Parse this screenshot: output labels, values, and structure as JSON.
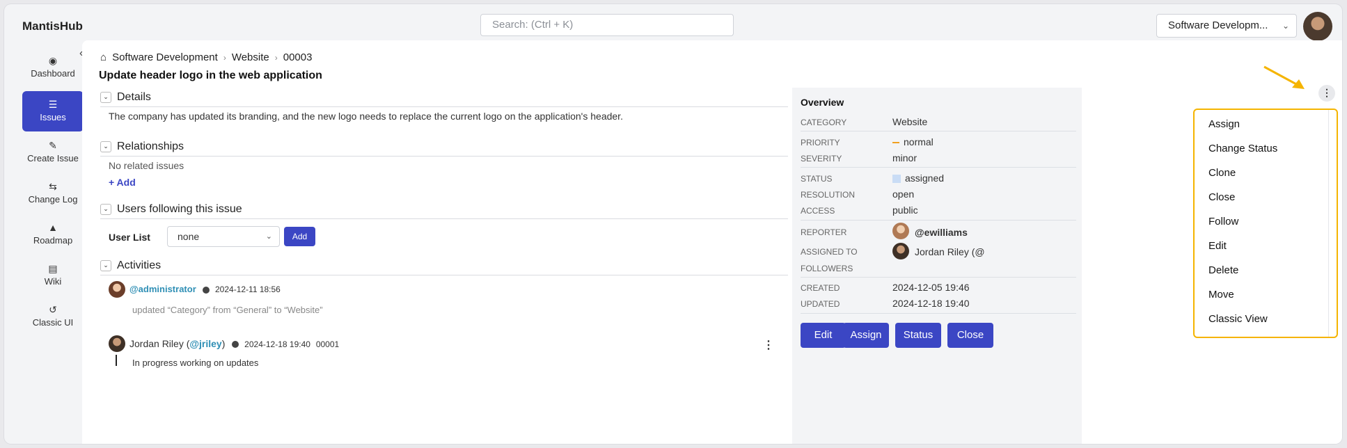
{
  "app": {
    "brand": "MantisHub"
  },
  "search": {
    "placeholder": "Search: (Ctrl + K)"
  },
  "project_selector": {
    "value": "Software Developm..."
  },
  "sidebar": {
    "items": [
      {
        "label": "Dashboard",
        "icon": "palette-icon"
      },
      {
        "label": "Issues",
        "icon": "list-icon"
      },
      {
        "label": "Create Issue",
        "icon": "edit-icon"
      },
      {
        "label": "Change Log",
        "icon": "change-log-icon"
      },
      {
        "label": "Roadmap",
        "icon": "roadmap-icon"
      },
      {
        "label": "Wiki",
        "icon": "document-icon"
      },
      {
        "label": "Classic UI",
        "icon": "history-icon"
      }
    ]
  },
  "breadcrumb": [
    "Software Development",
    "Website",
    "00003"
  ],
  "issue": {
    "title": "Update header logo in the web application"
  },
  "details": {
    "heading": "Details",
    "text": "The company has updated its branding, and the new logo needs to replace the current logo on the application's header."
  },
  "relationships": {
    "heading": "Relationships",
    "empty": "No related issues",
    "add": "+ Add"
  },
  "followers_section": {
    "heading": "Users following this issue",
    "label": "User List",
    "select_value": "none",
    "add_button": "Add"
  },
  "activities": {
    "heading": "Activities",
    "items": [
      {
        "user": "@administrator",
        "time": "2024-12-11 18:56",
        "text": "updated “Category” from “General” to “Website”"
      },
      {
        "name": "Jordan Riley (",
        "handle": "@jriley",
        "close": ")",
        "time": "2024-12-18 19:40",
        "id": "00001",
        "text": "In progress working on updates"
      }
    ]
  },
  "overview": {
    "title": "Overview",
    "fields": [
      {
        "label": "CATEGORY",
        "value": "Website"
      },
      {
        "label": "PRIORITY",
        "value": "normal"
      },
      {
        "label": "SEVERITY",
        "value": "minor"
      },
      {
        "label": "STATUS",
        "value": "assigned"
      },
      {
        "label": "RESOLUTION",
        "value": "open"
      },
      {
        "label": "ACCESS",
        "value": "public"
      },
      {
        "label": "REPORTER",
        "value": "@ewilliams"
      },
      {
        "label": "ASSIGNED TO",
        "value": "Jordan Riley (@"
      },
      {
        "label": "FOLLOWERS",
        "value": ""
      },
      {
        "label": "CREATED",
        "value": "2024-12-05 19:46"
      },
      {
        "label": "UPDATED",
        "value": "2024-12-18 19:40"
      }
    ],
    "buttons": [
      "Edit",
      "Assign",
      "Status",
      "Close"
    ]
  },
  "actions_menu": {
    "items": [
      "Assign",
      "Change Status",
      "Clone",
      "Close",
      "Follow",
      "Edit",
      "Delete",
      "Move",
      "Classic View"
    ]
  },
  "colors": {
    "accent": "#3b46c4",
    "highlight": "#f5b400",
    "handle": "#2f8fb5"
  }
}
